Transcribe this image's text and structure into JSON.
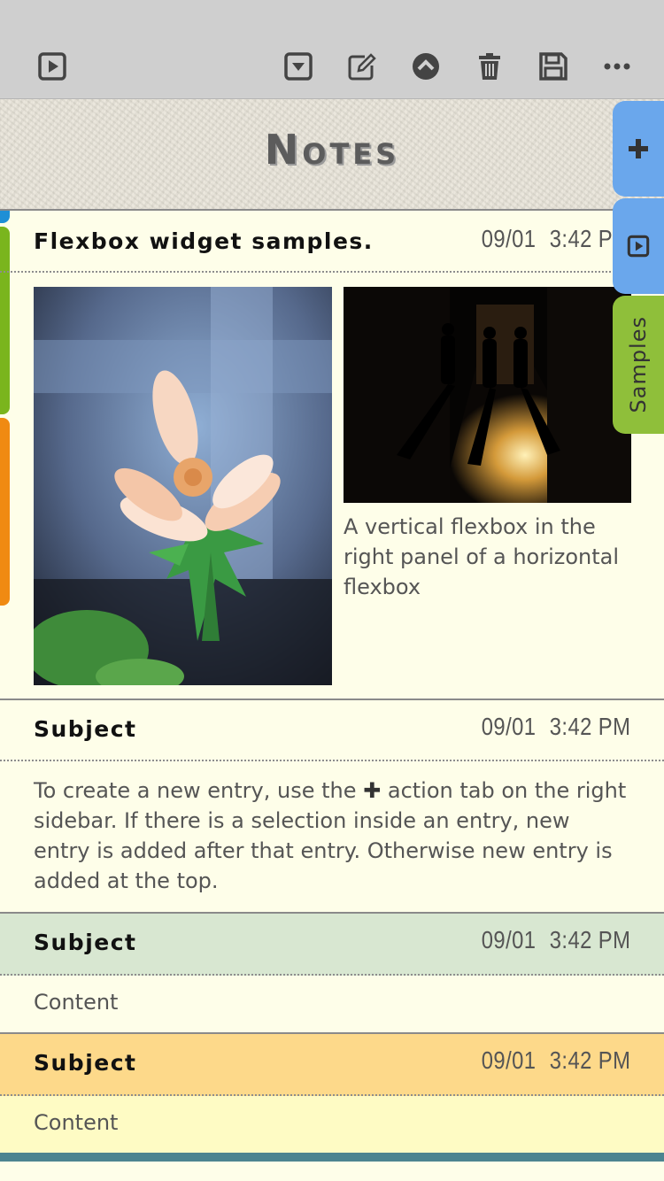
{
  "toolbar": {
    "buttons": [
      {
        "name": "play-icon"
      },
      {
        "name": "dropdown-icon"
      },
      {
        "name": "edit-icon"
      },
      {
        "name": "collapse-up-icon"
      },
      {
        "name": "trash-icon"
      },
      {
        "name": "save-icon"
      },
      {
        "name": "more-icon"
      }
    ]
  },
  "header": {
    "title": "Notes"
  },
  "sidebar_tabs": [
    {
      "icon": "plus-icon",
      "color": "#6aa7ec"
    },
    {
      "icon": "play-icon",
      "color": "#6aa7ec"
    },
    {
      "label": "Samples",
      "color": "#8fbf3a"
    }
  ],
  "left_strips": [
    {
      "color": "#1e8fd6"
    },
    {
      "color": "#7ab51d"
    },
    {
      "color": "#f08a12"
    }
  ],
  "entries": [
    {
      "subject": "Flexbox widget samples.",
      "date": "09/01",
      "time": "3:42 PM",
      "caption": "A vertical flexbox in the right panel of a horizontal flexbox"
    },
    {
      "subject": "Subject",
      "date": "09/01",
      "time": "3:42 PM",
      "content_before": "To create a new entry, use the ",
      "content_after": " action tab on the right sidebar. If there is a selection inside an entry, new entry is added after that entry. Otherwise new entry is added at the top."
    },
    {
      "subject": "Subject",
      "date": "09/01",
      "time": "3:42 PM",
      "content": "Content",
      "header_color": "#d8e7d1"
    },
    {
      "subject": "Subject",
      "date": "09/01",
      "time": "3:42 PM",
      "content": "Content",
      "header_color": "#fdd98a",
      "body_color": "#fefbc4"
    }
  ],
  "colors": {
    "toolbar": "#cfcfcf",
    "page": "#fefee9",
    "bottom_bar": "#4c8490"
  }
}
